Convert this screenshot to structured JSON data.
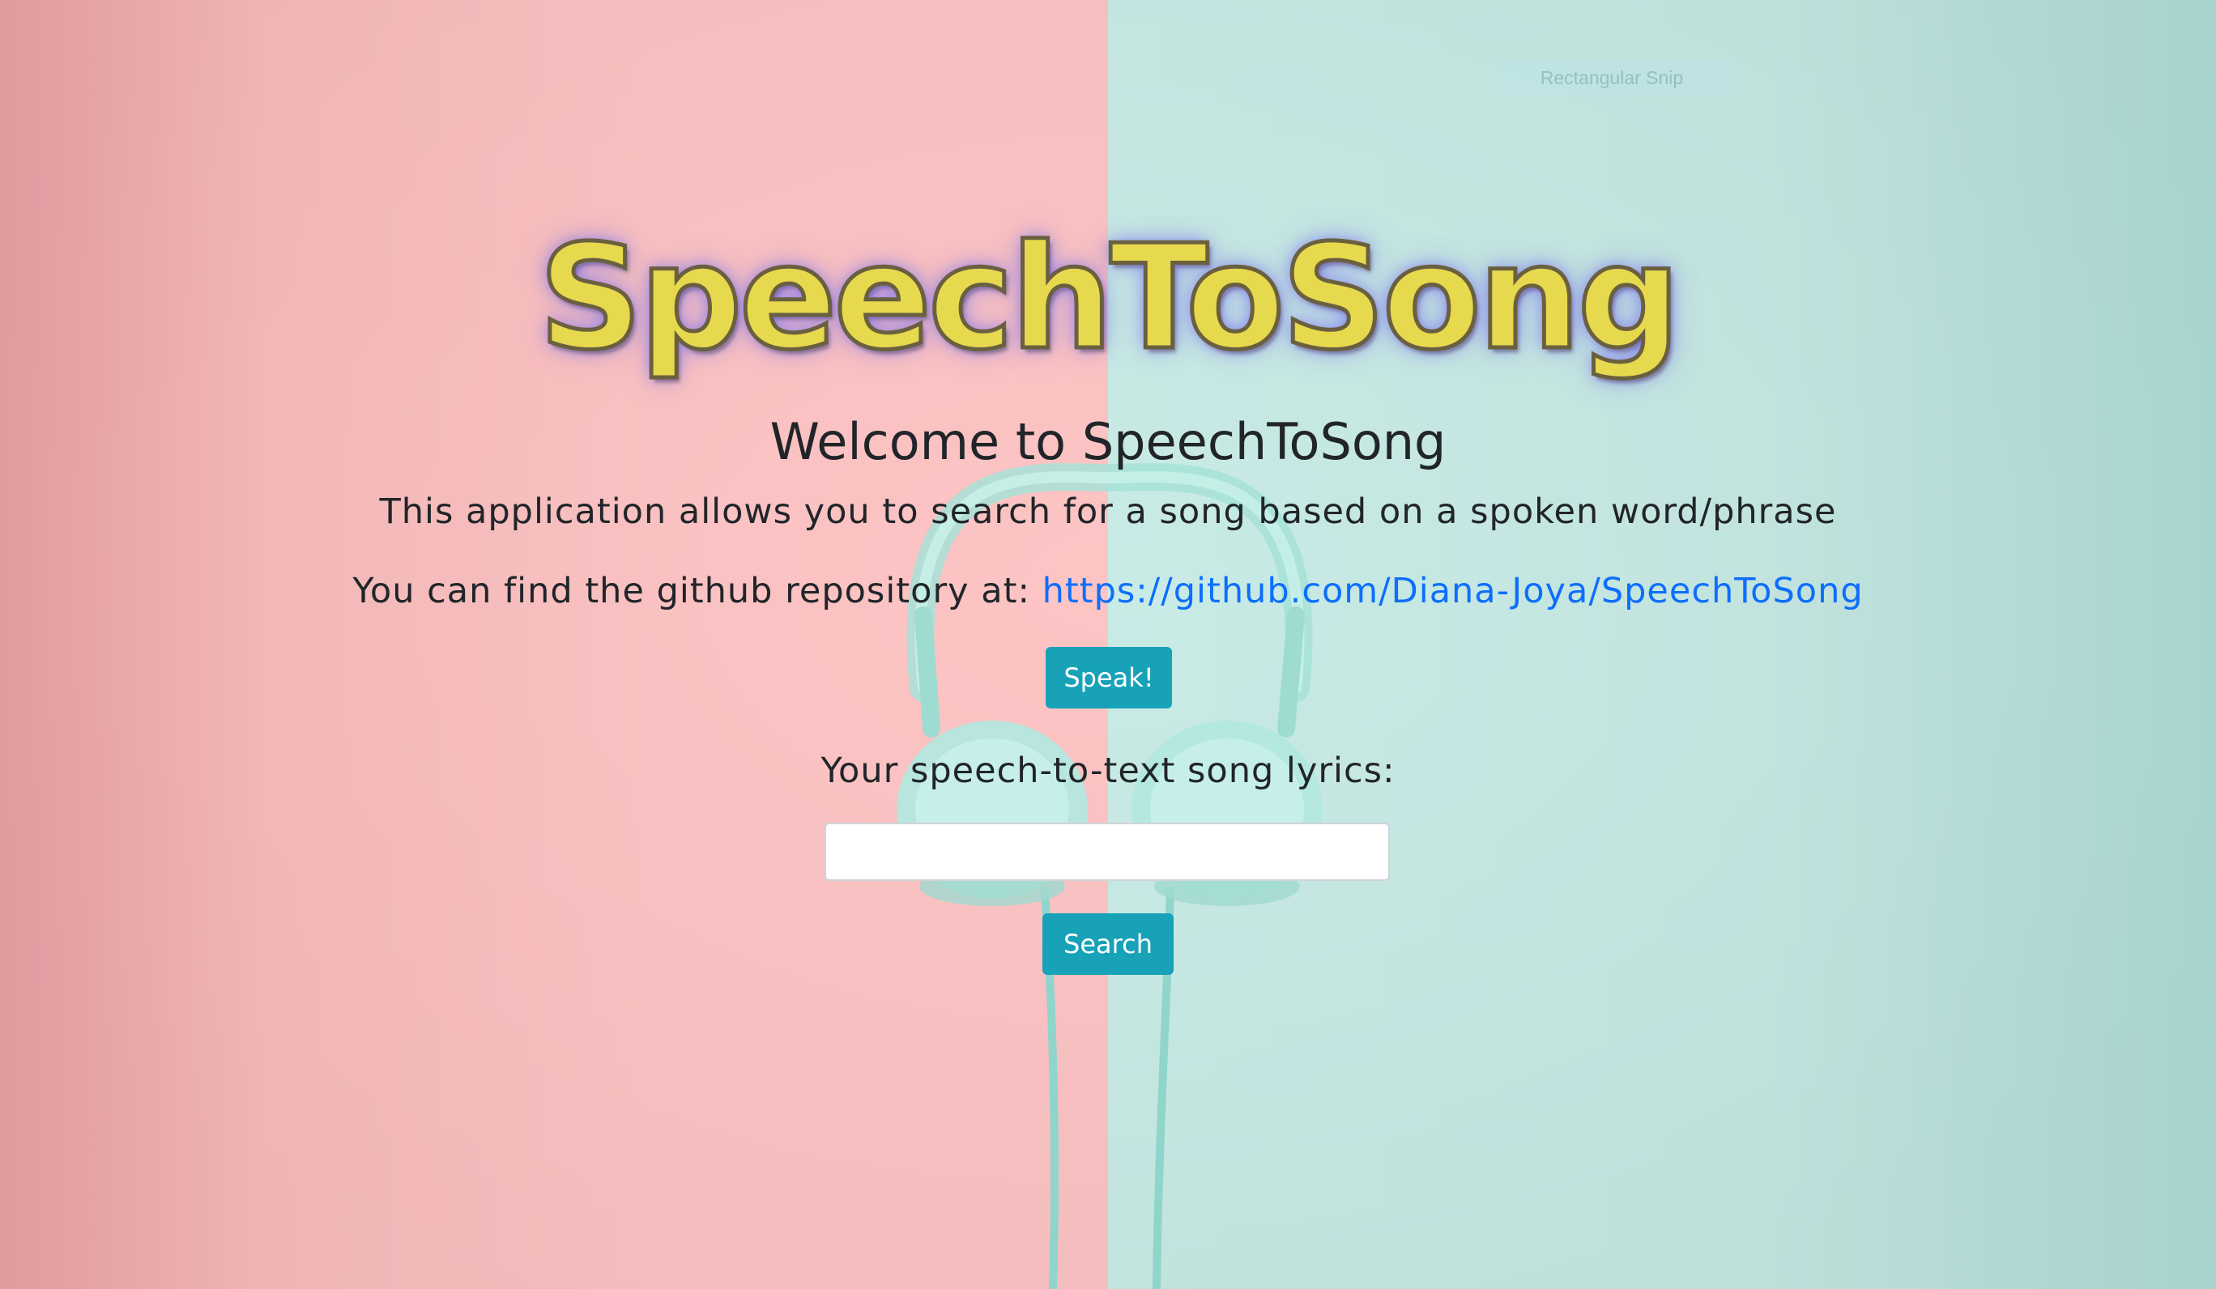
{
  "overlay": {
    "snip_label": "Rectangular Snip"
  },
  "header": {
    "logo_text": "SpeechToSong",
    "welcome_title": "Welcome to SpeechToSong"
  },
  "main": {
    "description": "This application allows you to search for a song based on a spoken word/phrase",
    "github_prefix": "You can find the github repository at: ",
    "github_link_text": "https://github.com/Diana-Joya/SpeechToSong",
    "speak_button_label": "Speak!",
    "lyrics_label": "Your speech-to-text song lyrics:",
    "lyrics_input_value": "",
    "lyrics_input_placeholder": "",
    "search_button_label": "Search"
  },
  "background": {
    "left_color": "#fdc4c4",
    "right_color": "#c9ebe6",
    "image": "headphones-icon"
  },
  "colors": {
    "logo": "#e7d94d",
    "button": "#17a2b8",
    "link": "#0d6efd",
    "text": "#212529"
  }
}
